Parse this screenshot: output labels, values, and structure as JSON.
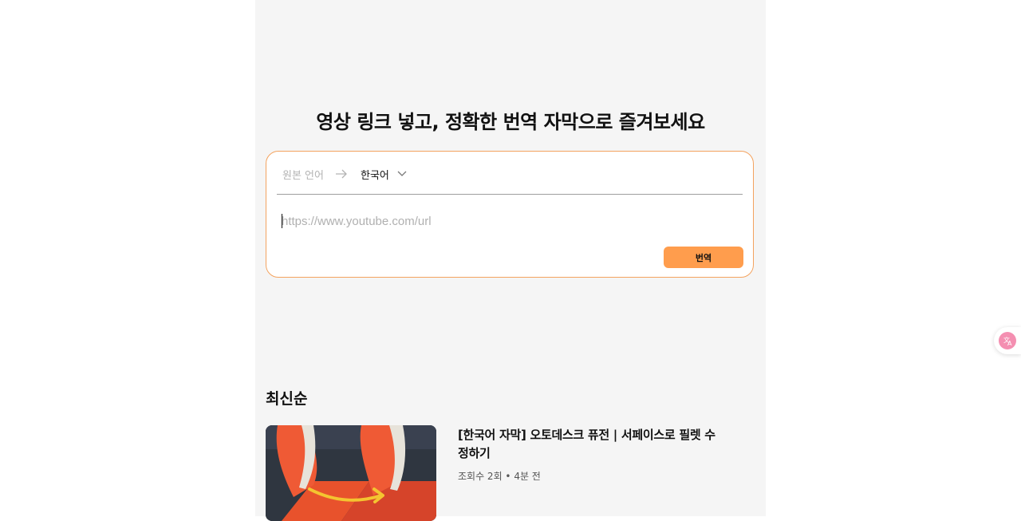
{
  "hero": {
    "title": "영상 링크 넣고, 정확한 번역 자막으로 즐겨보세요"
  },
  "translator": {
    "source_language": "원본 언어",
    "target_language": "한국어",
    "url_placeholder": "https://www.youtube.com/url",
    "url_value": "",
    "translate_label": "번역"
  },
  "feed": {
    "section_title": "최신순",
    "videos": [
      {
        "title": "[한국어 자막] 오토데스크 퓨전 | 서페이스로 필렛 수정하기",
        "meta": "조회수 2회 • 4분 전"
      }
    ]
  },
  "colors": {
    "accent": "#ff9d4d",
    "card_border": "#f4a35f",
    "panel_bg": "#f5f5f5"
  },
  "icons": {
    "arrow": "arrow-right-icon",
    "chevron": "chevron-down-icon",
    "float": "translate-icon"
  }
}
